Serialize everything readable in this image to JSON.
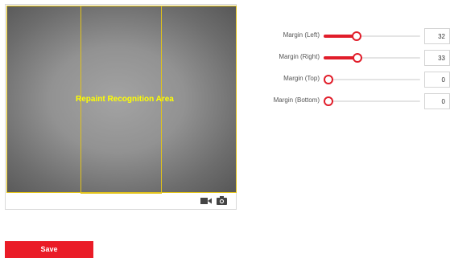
{
  "video": {
    "area_label": "Repaint Recognition Area",
    "toolbar_icons": [
      "video-camera-icon",
      "snapshot-camera-icon"
    ]
  },
  "settings": [
    {
      "label": "Margin (Left)",
      "value": "32",
      "percent": 32
    },
    {
      "label": "Margin (Right)",
      "value": "33",
      "percent": 33
    },
    {
      "label": "Margin (Top)",
      "value": "0",
      "percent": 0
    },
    {
      "label": "Margin (Bottom)",
      "value": "0",
      "percent": 0
    }
  ],
  "actions": {
    "save_label": "Save"
  },
  "colors": {
    "accent": "#e11d2a",
    "area_border": "#e1c21a",
    "area_label": "#ffff00"
  }
}
